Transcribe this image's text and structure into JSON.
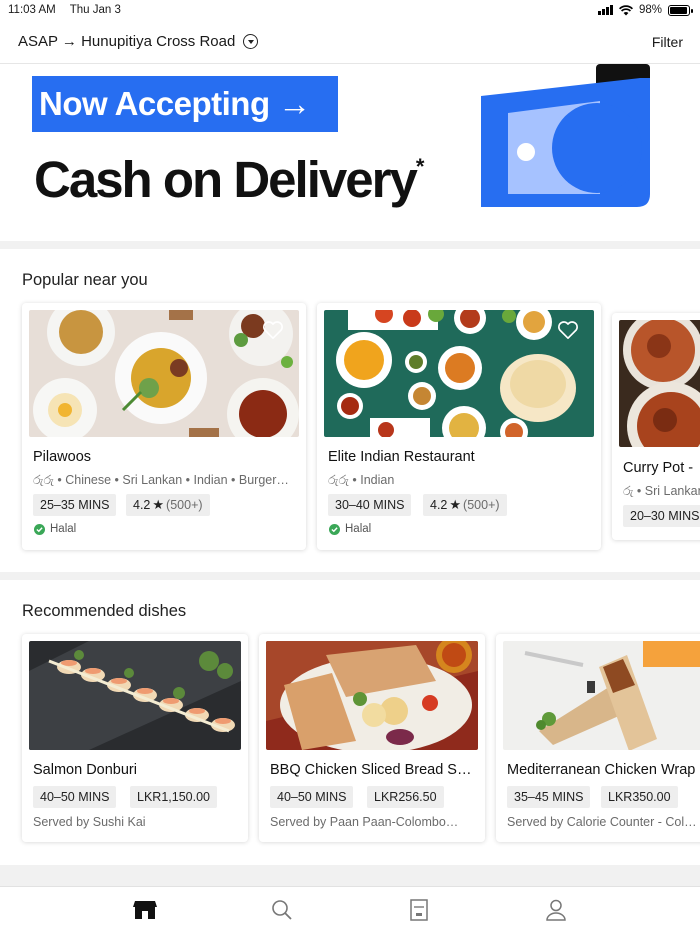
{
  "status_bar": {
    "time": "11:03 AM",
    "date": "Thu Jan 3",
    "battery": "98%",
    "battery_level": 0.98
  },
  "header": {
    "location": "ASAP → Hunupitiya Cross Road",
    "filter_label": "Filter"
  },
  "banner": {
    "tag": "Now Accepting →",
    "title": "Cash on Delivery",
    "asterisk": "*"
  },
  "popular": {
    "heading": "Popular near you",
    "restaurants": [
      {
        "name": "Pilawoos",
        "tags": "රුරු • Chinese • Sri Lankan • Indian • Burgers…",
        "time": "25–35 MINS",
        "rating": "4.2",
        "reviews": "(500+)",
        "badge": "Halal"
      },
      {
        "name": "Elite Indian Restaurant",
        "tags": "රුරු • Indian",
        "time": "30–40 MINS",
        "rating": "4.2",
        "reviews": "(500+)",
        "badge": "Halal"
      },
      {
        "name": "Curry Pot -",
        "tags": "රු • Sri Lankan",
        "time": "20–30 MINS"
      }
    ]
  },
  "recommended": {
    "heading": "Recommended dishes",
    "dishes": [
      {
        "name": "Salmon Donburi",
        "time": "40–50 MINS",
        "price": "LKR1,150.00",
        "served_by": "Served by Sushi Kai"
      },
      {
        "name": "BBQ Chicken Sliced Bread Sa…",
        "time": "40–50 MINS",
        "price": "LKR256.50",
        "served_by": "Served by Paan Paan-Colombo…"
      },
      {
        "name": "Mediterranean Chicken Wrap",
        "time": "35–45 MINS",
        "price": "LKR350.00",
        "served_by": "Served by Calorie Counter - Col…"
      }
    ]
  },
  "nav": {
    "items": [
      "home-icon",
      "search-icon",
      "orders-icon",
      "account-icon"
    ]
  },
  "colors": {
    "brand_blue": "#276ef1",
    "halal_green": "#3aa757",
    "banner_light_blue": "#a6c2ff"
  }
}
